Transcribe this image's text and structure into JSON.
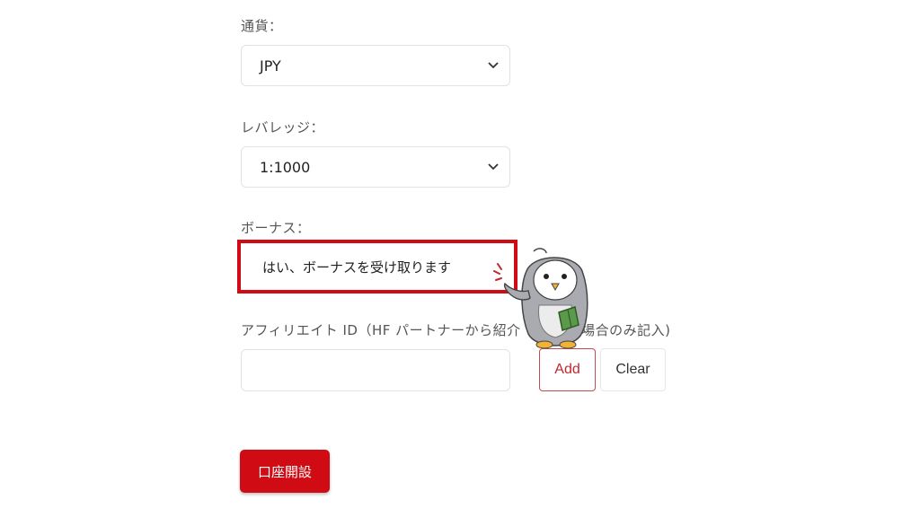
{
  "form": {
    "currency": {
      "label": "通貨：",
      "selected": "JPY"
    },
    "leverage": {
      "label": "レバレッジ：",
      "selected": "1:1000"
    },
    "bonus": {
      "label": "ボーナス：",
      "selected": "はい、ボーナスを受け取ります"
    },
    "affiliate": {
      "label": "アフィリエイト ID（HF パートナーから紹介",
      "label_tail": "る場合のみ記入)",
      "value": "",
      "add_label": "Add",
      "clear_label": "Clear"
    },
    "submit_label": "口座開設"
  },
  "colors": {
    "accent_red": "#d10b14",
    "border_gray": "#e2e2e2"
  },
  "icons": {
    "dropdown": "chevron-down-icon",
    "mascot": "penguin-mascot-icon"
  }
}
